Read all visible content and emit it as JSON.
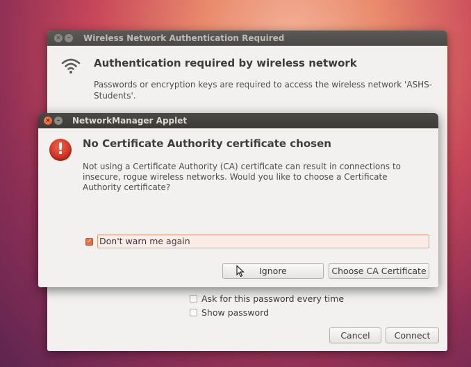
{
  "back_dialog": {
    "title": "Wireless Network Authentication Required",
    "close_glyph": "×",
    "min_glyph": "–",
    "icon": "wifi-icon",
    "heading": "Authentication required by wireless network",
    "description": "Passwords or encryption keys are required to access the wireless network 'ASHS-Students'.",
    "checkboxes": [
      {
        "label": "Ask for this password every time",
        "checked": false
      },
      {
        "label": "Show password",
        "checked": false
      }
    ],
    "buttons": {
      "cancel": "Cancel",
      "connect": "Connect"
    }
  },
  "front_dialog": {
    "title": "NetworkManager Applet",
    "close_glyph": "×",
    "min_glyph": "–",
    "icon": "warning-icon",
    "icon_glyph": "!",
    "heading": "No Certificate Authority certificate chosen",
    "description": "Not using a Certificate Authority (CA) certificate can result in connections to insecure, rogue wireless networks.  Would you like to choose a Certificate Authority certificate?",
    "dont_warn": {
      "label": "Don't warn me again",
      "checked": true,
      "check_glyph": "✓"
    },
    "buttons": {
      "ignore": "Ignore",
      "choose": "Choose CA Certificate"
    }
  },
  "colors": {
    "accent_orange": "#ea6c3f",
    "titlebar_dark": "#3c3b37",
    "window_bg": "#f2f1f0"
  }
}
